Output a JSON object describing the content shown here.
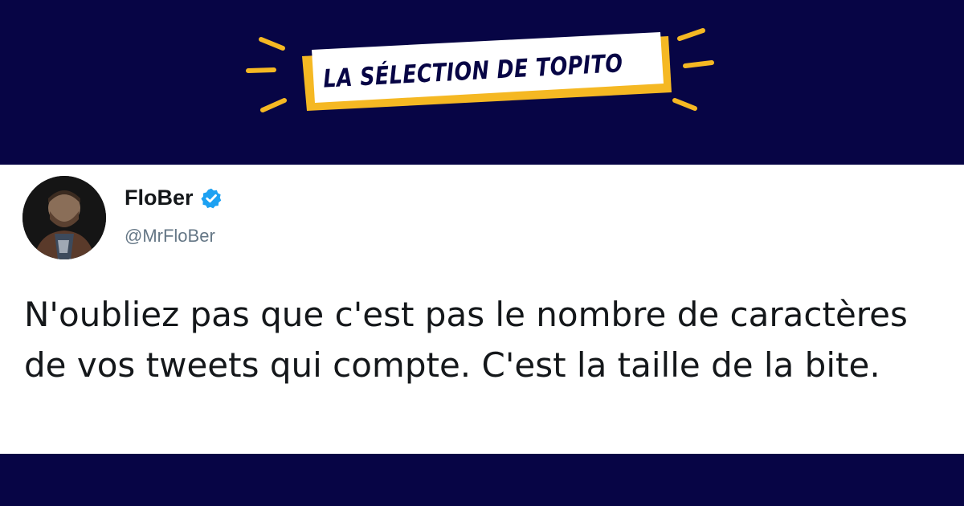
{
  "banner": {
    "title": "LA SÉLECTION DE TOPITO",
    "colors": {
      "background": "#070545",
      "accent": "#f5b823",
      "label_bg": "#ffffff"
    }
  },
  "tweet": {
    "author_name": "FloBer",
    "handle": "@MrFloBer",
    "verified": true,
    "text": "N'oubliez pas que c'est pas le nombre de caractères de vos tweets qui compte. C'est la taille de la bite.",
    "colors": {
      "text": "#14171a",
      "handle": "#657786",
      "verified": "#1da1f2"
    }
  }
}
